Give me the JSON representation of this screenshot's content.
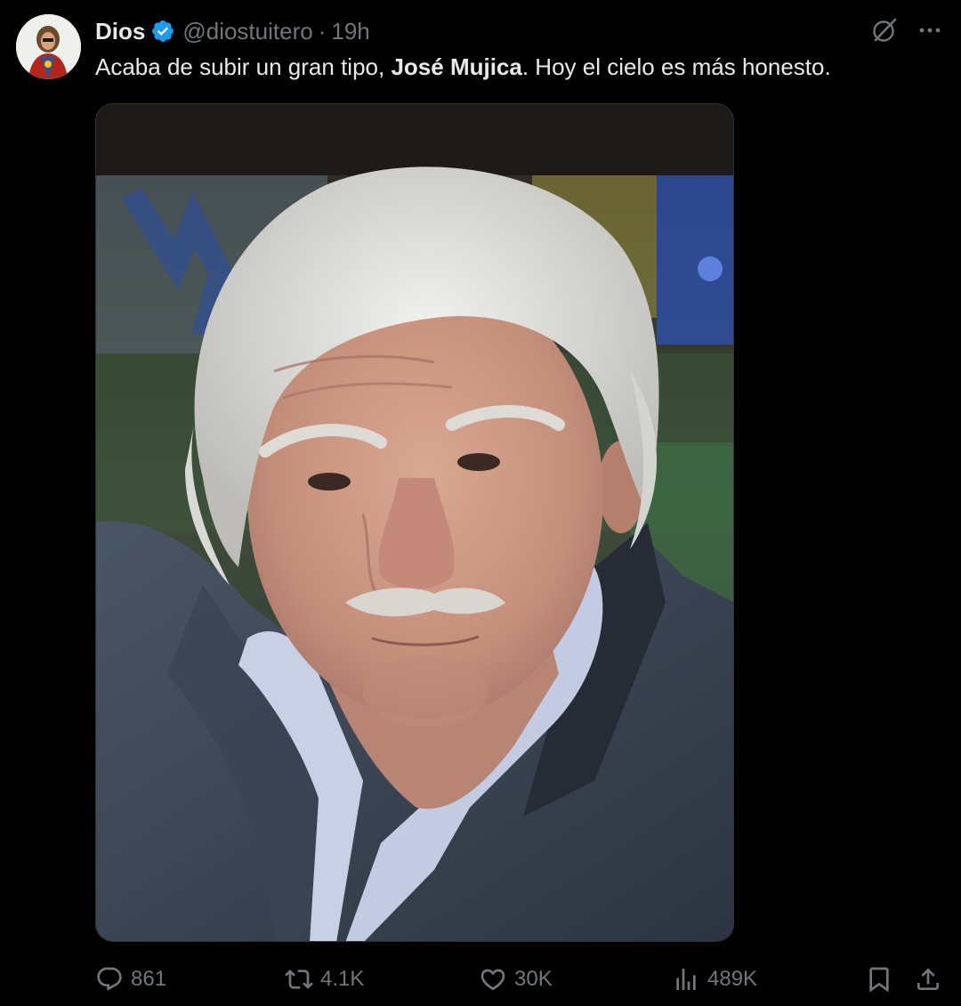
{
  "author": {
    "display_name": "Dios",
    "handle": "@diostuitero",
    "separator": "·",
    "time": "19h",
    "verified": true,
    "verified_color": "#1d9bf0"
  },
  "tweet": {
    "text_before": "Acaba de subir un gran tipo, ",
    "text_bold": "José Mujica",
    "text_after": ". Hoy el cielo es más honesto."
  },
  "media": {
    "type": "photo"
  },
  "actions": {
    "replies": "861",
    "reposts": "4.1K",
    "likes": "30K",
    "views": "489K"
  },
  "icons": {
    "avatar": "avatar-icon",
    "verified": "verified-badge-icon",
    "grok": "grok-icon",
    "more": "more-icon",
    "reply": "reply-icon",
    "repost": "repost-icon",
    "like": "heart-icon",
    "views": "views-icon",
    "bookmark": "bookmark-icon",
    "share": "share-icon"
  },
  "colors": {
    "background": "#000000",
    "text": "#e7e9ea",
    "muted": "#71767b"
  }
}
